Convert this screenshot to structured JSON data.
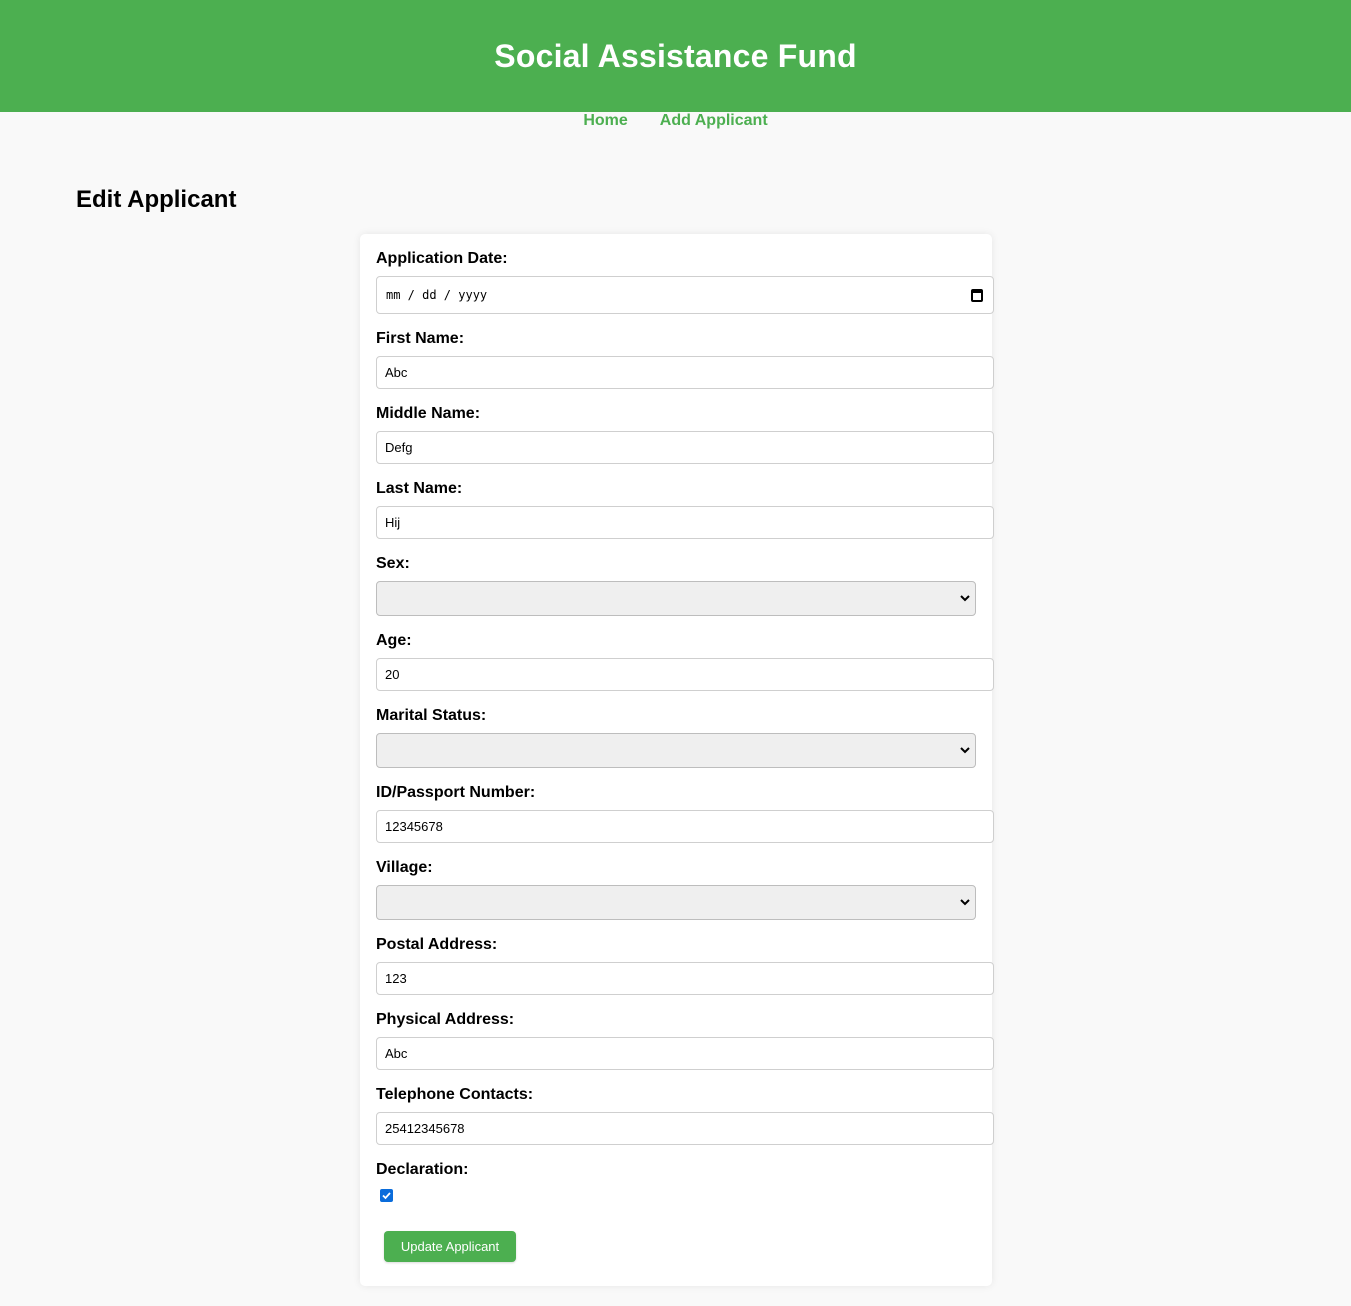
{
  "header": {
    "title": "Social Assistance Fund"
  },
  "nav": {
    "home": "Home",
    "add_applicant": "Add Applicant"
  },
  "page": {
    "title": "Edit Applicant"
  },
  "form": {
    "application_date": {
      "label": "Application Date:",
      "placeholder": "mm / dd / yyyy"
    },
    "first_name": {
      "label": "First Name:",
      "value": "Abc"
    },
    "middle_name": {
      "label": "Middle Name:",
      "value": "Defg"
    },
    "last_name": {
      "label": "Last Name:",
      "value": "Hij"
    },
    "sex": {
      "label": "Sex:",
      "value": ""
    },
    "age": {
      "label": "Age:",
      "value": "20"
    },
    "marital_status": {
      "label": "Marital Status:",
      "value": ""
    },
    "id_passport": {
      "label": "ID/Passport Number:",
      "value": "12345678"
    },
    "village": {
      "label": "Village:",
      "value": ""
    },
    "postal_address": {
      "label": "Postal Address:",
      "value": "123"
    },
    "physical_address": {
      "label": "Physical Address:",
      "value": "Abc"
    },
    "telephone": {
      "label": "Telephone Contacts:",
      "value": "25412345678"
    },
    "declaration": {
      "label": "Declaration:",
      "checked": true
    },
    "submit_label": "Update Applicant"
  },
  "colors": {
    "accent": "#4caf50",
    "checkbox": "#0a6cdb"
  }
}
